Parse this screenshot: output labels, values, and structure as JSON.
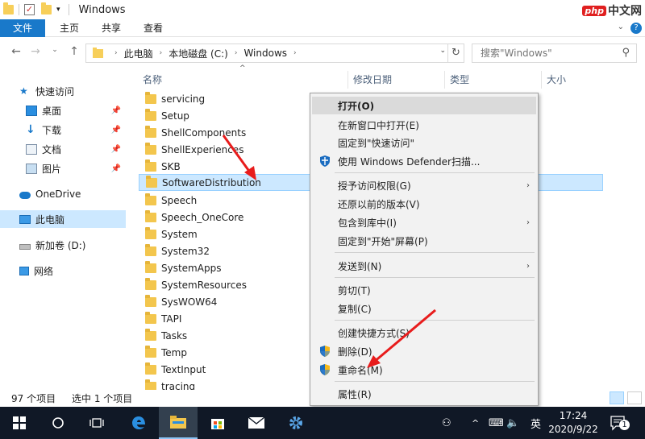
{
  "titlebar": {
    "title": "Windows",
    "brand_badge": "php",
    "brand_text": "中文网"
  },
  "ribbon": {
    "tabs": [
      "文件",
      "主页",
      "共享",
      "查看"
    ]
  },
  "address": {
    "crumbs": [
      "此电脑",
      "本地磁盘 (C:)",
      "Windows"
    ],
    "search_placeholder": "搜索\"Windows\""
  },
  "navpane": {
    "items": [
      {
        "label": "快速访问",
        "icon": "star-icon"
      },
      {
        "label": "桌面",
        "icon": "desktop-icon"
      },
      {
        "label": "下载",
        "icon": "download-icon"
      },
      {
        "label": "文档",
        "icon": "document-icon"
      },
      {
        "label": "图片",
        "icon": "picture-icon"
      },
      {
        "label": "OneDrive",
        "icon": "cloud-icon"
      },
      {
        "label": "此电脑",
        "icon": "computer-icon"
      },
      {
        "label": "新加卷 (D:)",
        "icon": "drive-icon"
      },
      {
        "label": "网络",
        "icon": "network-icon"
      }
    ]
  },
  "columns": {
    "name": "名称",
    "modified": "修改日期",
    "type": "类型",
    "size": "大小"
  },
  "files": [
    "servicing",
    "Setup",
    "ShellComponents",
    "ShellExperiences",
    "SKB",
    "SoftwareDistribution",
    "Speech",
    "Speech_OneCore",
    "System",
    "System32",
    "SystemApps",
    "SystemResources",
    "SysWOW64",
    "TAPI",
    "Tasks",
    "Temp",
    "TextInput",
    "tracing"
  ],
  "selected_file": "SoftwareDistribution",
  "context_menu": {
    "open": "打开(O)",
    "open_new_window": "在新窗口中打开(E)",
    "pin_quick_access": "固定到\"快速访问\"",
    "defender": "使用 Windows Defender扫描...",
    "grant_access": "授予访问权限(G)",
    "restore_versions": "还原以前的版本(V)",
    "include_library": "包含到库中(I)",
    "pin_start": "固定到\"开始\"屏幕(P)",
    "send_to": "发送到(N)",
    "cut": "剪切(T)",
    "copy": "复制(C)",
    "create_shortcut": "创建快捷方式(S)",
    "delete": "删除(D)",
    "rename": "重命名(M)",
    "properties": "属性(R)"
  },
  "status": {
    "item_count": "97 个项目",
    "selected": "选中 1 个项目"
  },
  "taskbar": {
    "ime": "英",
    "time": "17:24",
    "date": "2020/9/22",
    "notif_count": "1"
  },
  "colors": {
    "accent": "#1979ca",
    "selection": "#cce8ff",
    "arrow": "#e81c1c"
  }
}
